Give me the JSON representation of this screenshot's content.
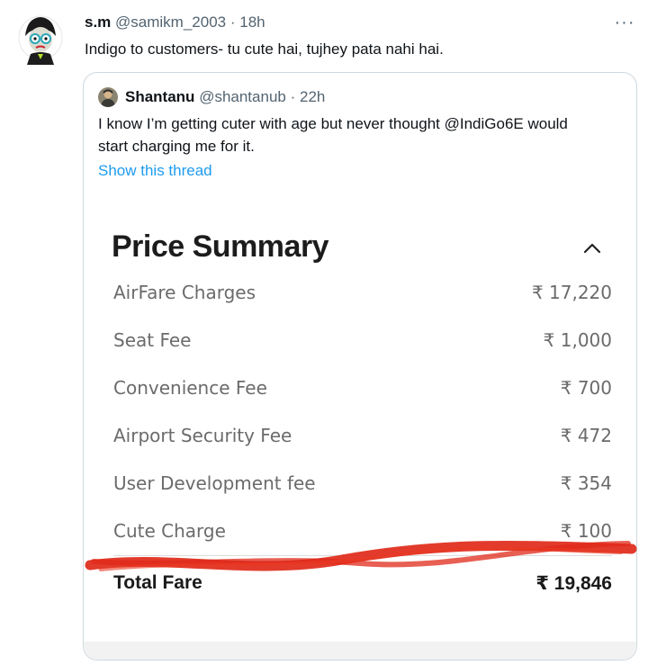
{
  "tweet": {
    "author_name": "s.m",
    "author_handle": "@samikm_2003",
    "separator": "·",
    "time": "18h",
    "text": "Indigo to customers- tu cute hai, tujhey pata nahi hai.",
    "more_icon": "···"
  },
  "quoted": {
    "author_name": "Shantanu",
    "author_handle": "@shantanub",
    "separator": "·",
    "time": "22h",
    "text_lines": [
      "I know I’m getting cuter with age but never thought @IndiGo6E would",
      "start charging me for it."
    ],
    "show_thread": "Show this thread",
    "receipt": {
      "title": "Price Summary",
      "rows": [
        {
          "label": "AirFare Charges",
          "amount": "₹ 17,220"
        },
        {
          "label": "Seat Fee",
          "amount": "₹ 1,000"
        },
        {
          "label": "Convenience Fee",
          "amount": "₹ 700"
        },
        {
          "label": "Airport Security Fee",
          "amount": "₹ 472"
        },
        {
          "label": "User Development fee",
          "amount": "₹ 354"
        },
        {
          "label": "Cute Charge",
          "amount": "₹ 100"
        }
      ],
      "total_label": "Total Fare",
      "total_amount": "₹ 19,846"
    }
  },
  "colors": {
    "link": "#1d9bf0",
    "scribble": "#e02a1a"
  }
}
